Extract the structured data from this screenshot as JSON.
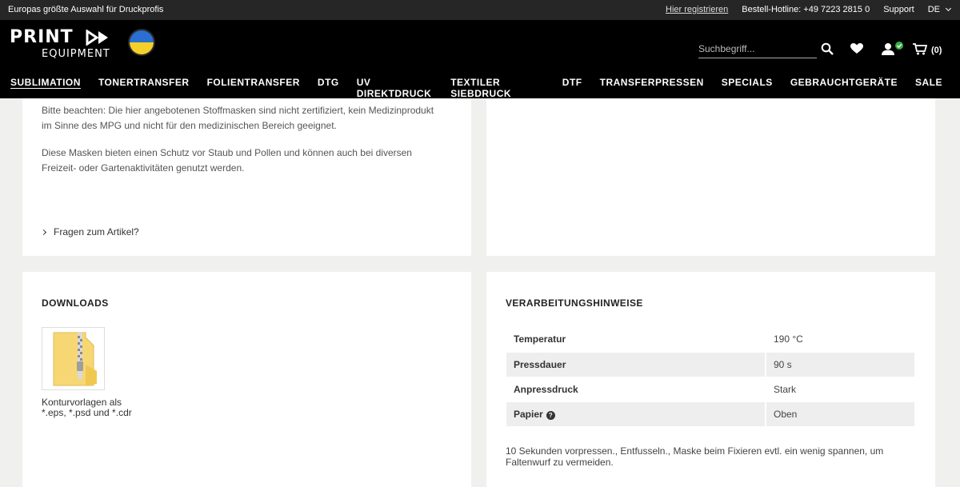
{
  "topbar": {
    "tagline": "Europas größte Auswahl für Druckprofis",
    "register": "Hier registrieren",
    "hotline": "Bestell-Hotline: +49 7223 2815 0",
    "support": "Support",
    "lang": "DE"
  },
  "header": {
    "logo_top": "PRINT",
    "logo_bottom": "EQUIPMENT",
    "search_placeholder": "Suchbegriff...",
    "cart_count": "(0)"
  },
  "nav": [
    "SUBLIMATION",
    "TONERTRANSFER",
    "FOLIENTRANSFER",
    "DTG",
    "UV DIREKTDRUCK",
    "TEXTILER SIEBDRUCK",
    "DTF",
    "TRANSFERPRESSEN",
    "SPECIALS",
    "GEBRAUCHTGERÄTE",
    "SALE"
  ],
  "description": {
    "para1": "Bitte beachten: Die hier angebotenen Stoffmasken sind nicht zertifiziert, kein Medizinprodukt im Sinne des MPG und nicht für den medizinischen Bereich geeignet.",
    "para2": "Diese Masken bieten einen Schutz vor Staub und Pollen und können auch bei diversen Freizeit- oder Gartenaktivitäten genutzt werden.",
    "faq": "Fragen zum Artikel?"
  },
  "downloads": {
    "title": "DOWNLOADS",
    "file_caption": "Konturvorlagen als *.eps, *.psd und *.cdr"
  },
  "processing": {
    "title": "VERARBEITUNGSHINWEISE",
    "rows": [
      {
        "label": "Temperatur",
        "value": "190 °C"
      },
      {
        "label": "Pressdauer",
        "value": "90 s"
      },
      {
        "label": "Anpressdruck",
        "value": "Stark"
      },
      {
        "label": "Papier",
        "value": "Oben"
      }
    ],
    "note": "10 Sekunden vorpressen., Entfusseln., Maske beim Fixieren evtl. ein wenig spannen, um Faltenwurf zu vermeiden."
  },
  "colors": {
    "header_bg": "#000000",
    "topbar_bg": "#262626",
    "page_bg": "#f0f0ef",
    "flag_blue": "#2a6fd1",
    "flag_yellow": "#f5d02b",
    "account_badge": "#3cb043"
  },
  "icons": [
    "search-icon",
    "heart-icon",
    "user-icon",
    "cart-icon",
    "zip-file-icon",
    "help-icon"
  ]
}
